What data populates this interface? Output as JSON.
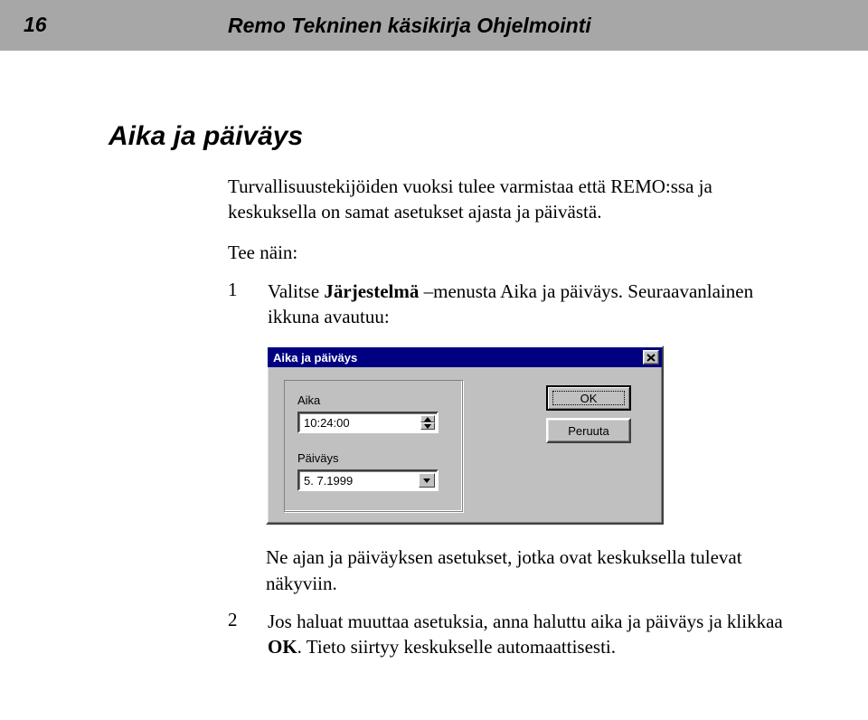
{
  "header": {
    "page_number": "16",
    "doc_title": "Remo Tekninen käsikirja  Ohjelmointi"
  },
  "section_title": "Aika ja päiväys",
  "intro": "Turvallisuustekijöiden vuoksi tulee varmistaa että REMO:ssa ja keskuksella on samat asetukset ajasta ja päivästä.",
  "tee_nain": "Tee näin:",
  "steps": [
    {
      "num": "1",
      "prefix": "Valitse ",
      "bold": "Järjestelmä",
      "suffix": " –menusta Aika ja päiväys. Seuraavanlainen ikkuna avautuu:"
    },
    {
      "num": "2",
      "prefix": "Jos haluat muuttaa asetuksia, anna haluttu aika ja päiväys ja klikkaa ",
      "bold": "OK",
      "suffix": ". Tieto siirtyy keskukselle automaattisesti."
    }
  ],
  "followup": "Ne ajan ja päiväyksen asetukset, jotka ovat keskuksella tulevat näkyviin.",
  "dialog": {
    "title": "Aika ja päiväys",
    "label_time": "Aika",
    "label_date": "Päiväys",
    "value_time": "10:24:00",
    "value_date": "5. 7.1999",
    "btn_ok": "OK",
    "btn_cancel": "Peruuta"
  }
}
